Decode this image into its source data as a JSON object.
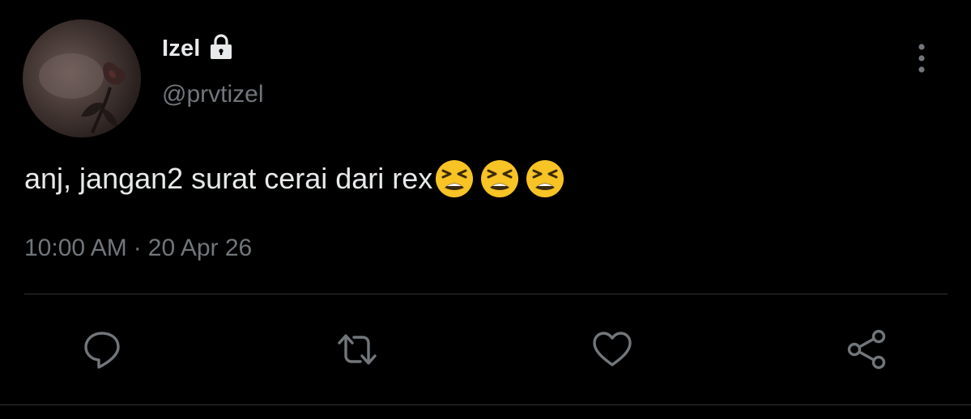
{
  "author": {
    "display_name": "Izel",
    "handle": "@prvtizel",
    "protected_icon": "lock-icon",
    "avatar": "profile-photo-dark-rose"
  },
  "tweet": {
    "text": "anj, jangan2 surat cerai dari rex",
    "emojis": [
      "tired-face-emoji",
      "tired-face-emoji",
      "tired-face-emoji"
    ],
    "time": "10:00 AM",
    "separator": "·",
    "date": "20 Apr 26"
  },
  "actions": [
    {
      "name": "reply",
      "icon": "reply-icon"
    },
    {
      "name": "retweet",
      "icon": "retweet-icon"
    },
    {
      "name": "like",
      "icon": "heart-icon"
    },
    {
      "name": "share",
      "icon": "share-icon"
    }
  ],
  "menu_icon": "more-vertical-icon",
  "colors": {
    "background": "#000000",
    "primary_text": "#e7e9ea",
    "secondary_text": "#71767b",
    "divider": "#2f3336",
    "emoji_yellow": "#f7c325"
  }
}
